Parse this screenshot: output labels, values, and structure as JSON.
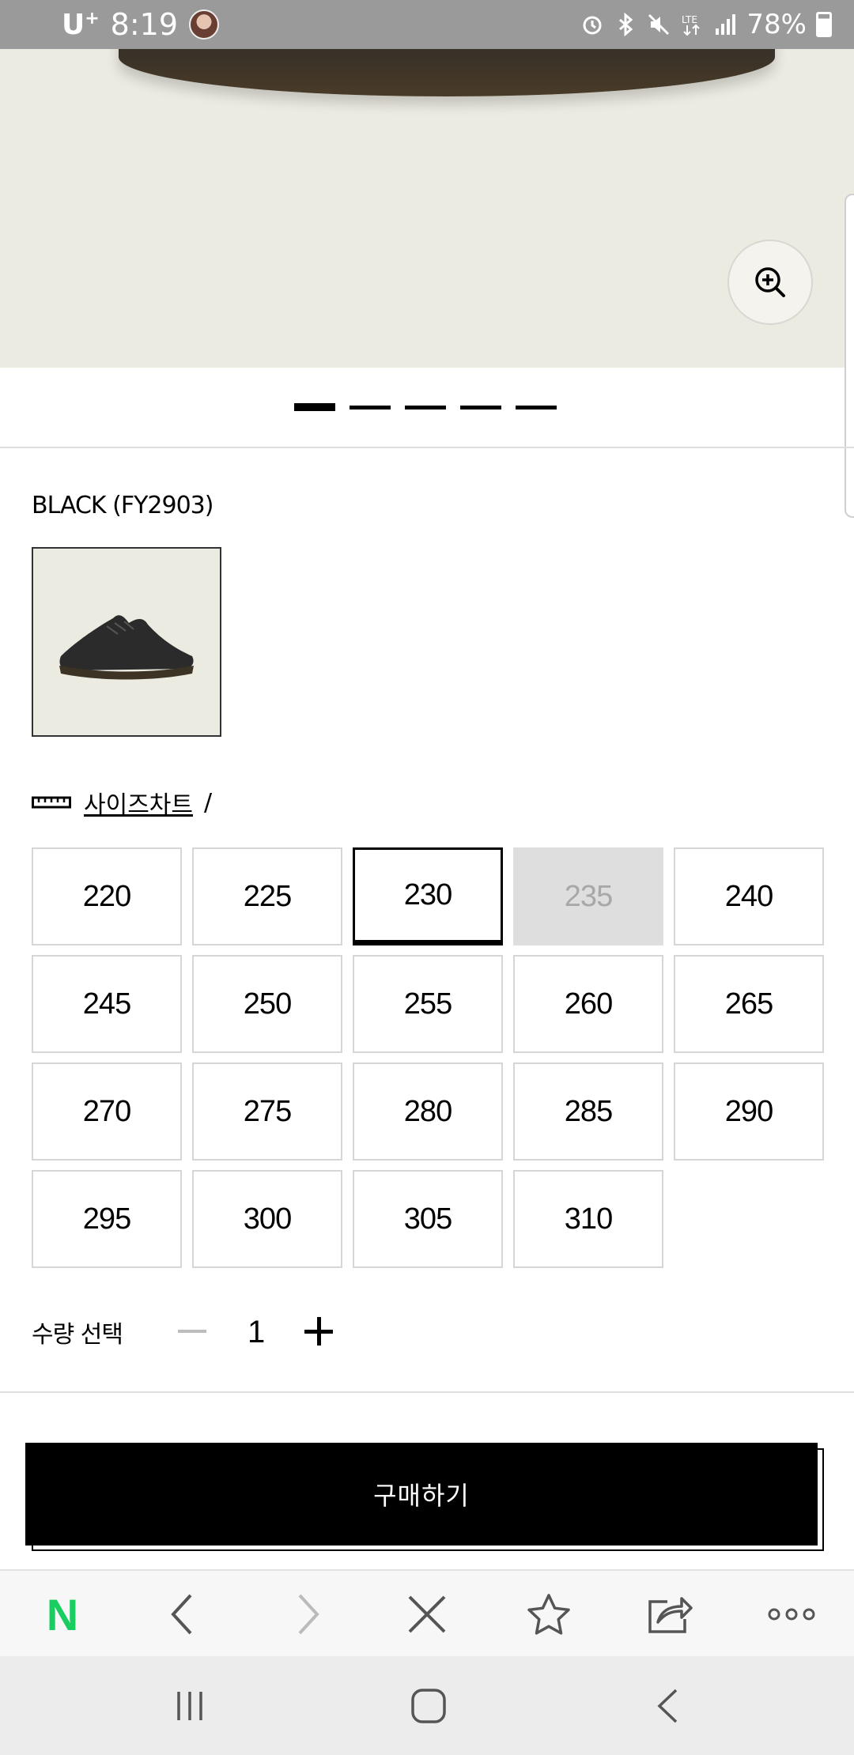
{
  "status_bar": {
    "carrier": "U",
    "carrier_sup": "+",
    "time": "8:19",
    "battery": "78%"
  },
  "product": {
    "color_label": "BLACK (FY2903)",
    "pager": {
      "count": 5,
      "active_index": 0
    }
  },
  "size_chart": {
    "link_label": "사이즈차트",
    "separator": "/"
  },
  "sizes": [
    {
      "label": "220",
      "state": "available"
    },
    {
      "label": "225",
      "state": "available"
    },
    {
      "label": "230",
      "state": "selected"
    },
    {
      "label": "235",
      "state": "sold_out"
    },
    {
      "label": "240",
      "state": "available"
    },
    {
      "label": "245",
      "state": "available"
    },
    {
      "label": "250",
      "state": "available"
    },
    {
      "label": "255",
      "state": "available"
    },
    {
      "label": "260",
      "state": "available"
    },
    {
      "label": "265",
      "state": "available"
    },
    {
      "label": "270",
      "state": "available"
    },
    {
      "label": "275",
      "state": "available"
    },
    {
      "label": "280",
      "state": "available"
    },
    {
      "label": "285",
      "state": "available"
    },
    {
      "label": "290",
      "state": "available"
    },
    {
      "label": "295",
      "state": "available"
    },
    {
      "label": "300",
      "state": "available"
    },
    {
      "label": "305",
      "state": "available"
    },
    {
      "label": "310",
      "state": "available"
    }
  ],
  "quantity": {
    "label": "수량 선택",
    "value": "1"
  },
  "buy_button": {
    "label": "구매하기"
  },
  "browser_toolbar": {
    "home_logo": "N",
    "icons": [
      "naver-home-icon",
      "back-icon",
      "forward-icon",
      "close-icon",
      "star-icon",
      "share-icon",
      "more-icon"
    ]
  },
  "colors": {
    "accent_green": "#19ce60",
    "hero_bg": "#ecebe2",
    "sold_out_bg": "#dedede",
    "status_bar_bg": "#9a9a9a"
  }
}
